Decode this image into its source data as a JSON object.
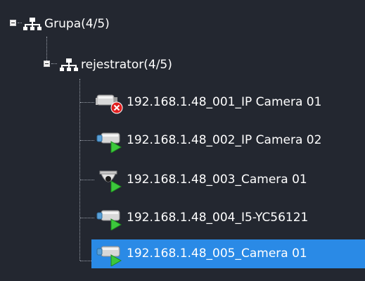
{
  "tree": {
    "group": {
      "label": "Grupa(4/5)",
      "icon": "network-topology-icon",
      "expanded": true
    },
    "recorder": {
      "label": "rejestrator(4/5)",
      "icon": "network-topology-icon",
      "expanded": true
    },
    "cameras": [
      {
        "label": "192.168.1.48_001_IP Camera 01",
        "icon": "bullet-camera-offline-icon",
        "status": "offline",
        "selected": false
      },
      {
        "label": "192.168.1.48_002_IP Camera 02",
        "icon": "bullet-camera-online-icon",
        "status": "online",
        "selected": false
      },
      {
        "label": "192.168.1.48_003_Camera 01",
        "icon": "dome-camera-online-icon",
        "status": "online",
        "selected": false
      },
      {
        "label": "192.168.1.48_004_I5-YC56121",
        "icon": "bullet-camera-online-icon",
        "status": "online",
        "selected": false
      },
      {
        "label": "192.168.1.48_005_Camera 01",
        "icon": "bullet-camera-online-icon",
        "status": "online",
        "selected": true
      }
    ]
  },
  "colors": {
    "background": "#232730",
    "selection": "#2a8ae6",
    "online": "#3cc83c",
    "offline": "#e02020"
  }
}
